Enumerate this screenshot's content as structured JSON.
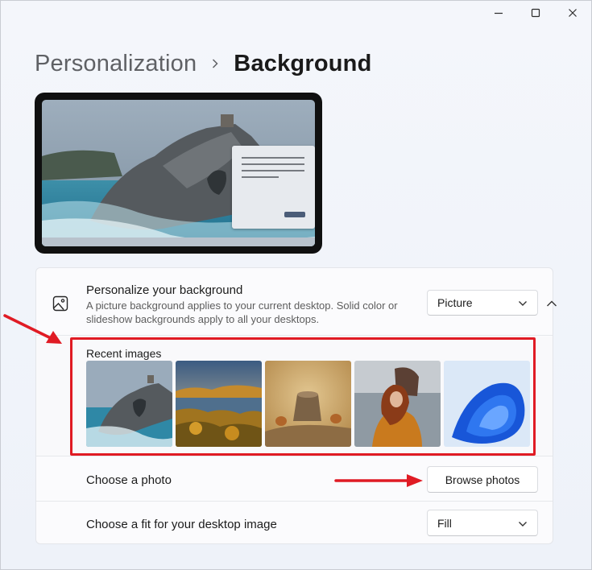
{
  "window": {
    "controls": [
      "minimize",
      "maximize",
      "close"
    ]
  },
  "breadcrumb": {
    "parent": "Personalization",
    "separator_icon": "chevron-right-icon",
    "current": "Background"
  },
  "background_setting": {
    "icon": "image-icon",
    "title": "Personalize your background",
    "description": "A picture background applies to your current desktop. Solid color or slideshow backgrounds apply to all your desktops.",
    "type_value": "Picture",
    "expanded": true
  },
  "recent_images": {
    "label": "Recent images",
    "items": [
      {
        "subject": "coastal-cliff"
      },
      {
        "subject": "autumn-lake"
      },
      {
        "subject": "squirrels-on-stump"
      },
      {
        "subject": "woman-by-sea"
      },
      {
        "subject": "blue-bloom"
      }
    ]
  },
  "choose_photo": {
    "label": "Choose a photo",
    "button_label": "Browse photos"
  },
  "choose_fit": {
    "label": "Choose a fit for your desktop image",
    "value": "Fill"
  },
  "annotations": {
    "highlight_color": "#e01b24",
    "arrow_color": "#e01b24"
  }
}
